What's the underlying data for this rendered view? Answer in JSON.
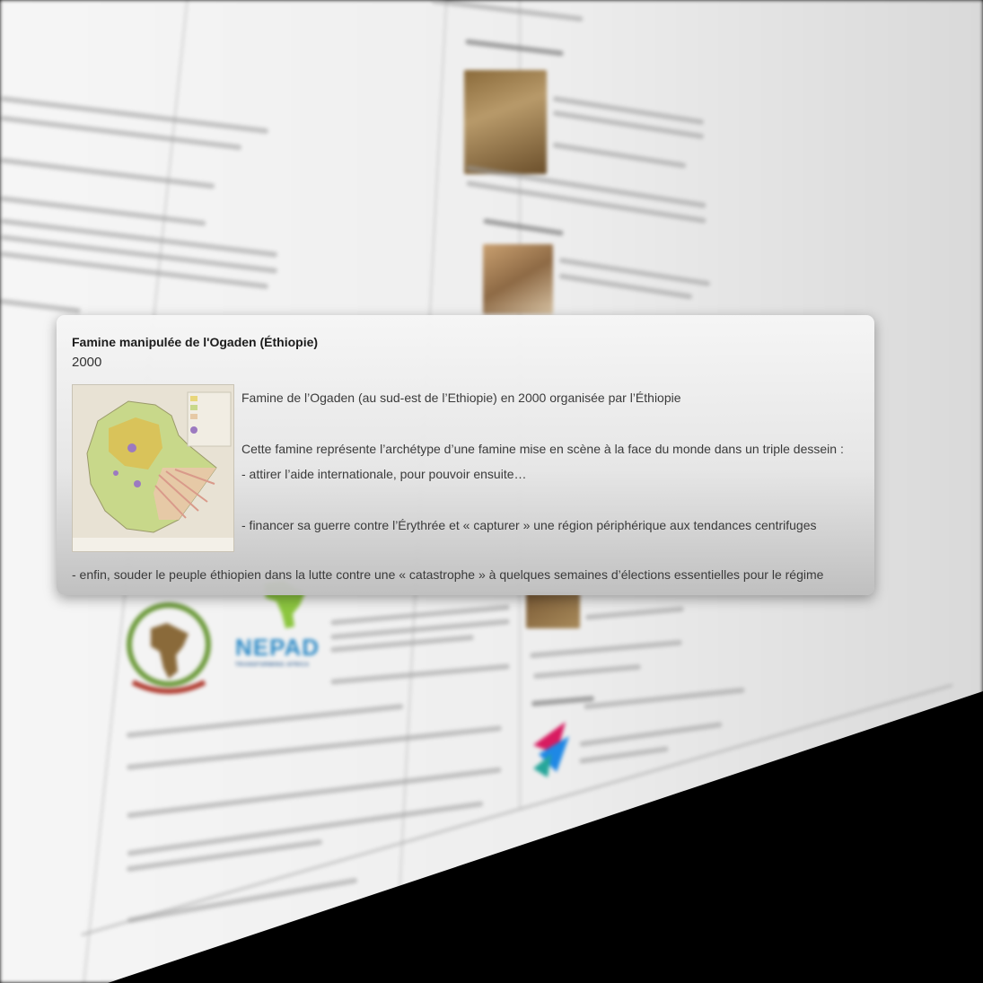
{
  "popup": {
    "title": "Famine manipulée de l'Ogaden (Éthiopie)",
    "year": "2000",
    "paragraphs": [
      "Famine de l’Ogaden (au sud-est de l’Ethiopie) en 2000 organisée par l’Éthiopie",
      "Cette famine représente l’archétype d’une famine mise en scène à la face du monde dans un triple dessein :",
      "- attirer l’aide internationale, pour pouvoir ensuite…",
      "- financer sa guerre contre l’Érythrée et « capturer » une région périphérique aux tendances centrifuges",
      "- enfin, souder le peuple éthiopien dans la lutte contre une « catastrophe » à quelques semaines d’élections essentielles pour le régime"
    ],
    "map_image": "ethiopia-map-thumbnail"
  },
  "background": {
    "logos": [
      "african-union-logo",
      "nepad-logo",
      "espace-logo"
    ],
    "nepad_text": "NEPAD",
    "nepad_tagline": "TRANSFORMING AFRICA"
  },
  "colors": {
    "popup_bg_top": "#f6f6f6",
    "popup_bg_bottom": "#bebebe",
    "page_bg": "#efefef",
    "outside_bg": "#000000",
    "nepad_blue": "#2e8bc7",
    "nepad_green": "#8cc63f"
  }
}
